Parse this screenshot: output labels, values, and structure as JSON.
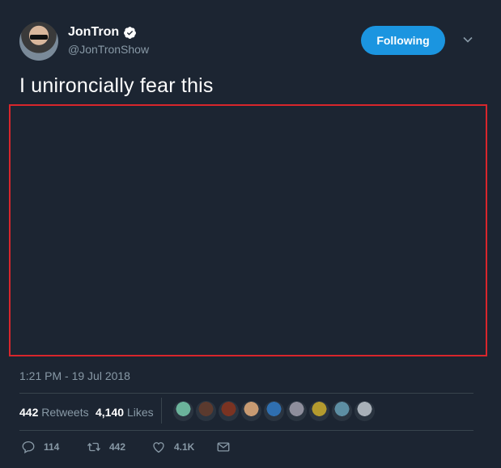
{
  "author": {
    "display_name": "JonTron",
    "handle": "@JonTronShow",
    "avatar_icon": "user-avatar",
    "verified_icon": "verified-badge-icon"
  },
  "follow_button": {
    "label": "Following"
  },
  "menu": {
    "icon": "chevron-down-icon"
  },
  "tweet": {
    "text": "I unironcially fear this",
    "timestamp": "1:21 PM - 19 Jul 2018"
  },
  "stats": {
    "retweets_count": "442",
    "retweets_label": "Retweets",
    "likes_count": "4,140",
    "likes_label": "Likes",
    "liker_avatars": [
      {
        "color": "#6bb39b"
      },
      {
        "color": "#5b3a2e"
      },
      {
        "color": "#7a3322"
      },
      {
        "color": "#c79a72"
      },
      {
        "color": "#2f6fb0"
      },
      {
        "color": "#8e8e9c"
      },
      {
        "color": "#b39a2e"
      },
      {
        "color": "#5d8ea3"
      },
      {
        "color": "#a8b0b8"
      }
    ]
  },
  "actions": {
    "replies": "114",
    "retweets": "442",
    "likes": "4.1K"
  },
  "colors": {
    "background": "#1c2532",
    "accent": "#1b95e0",
    "muted": "#8899a6",
    "highlight_border": "#d8262c"
  }
}
